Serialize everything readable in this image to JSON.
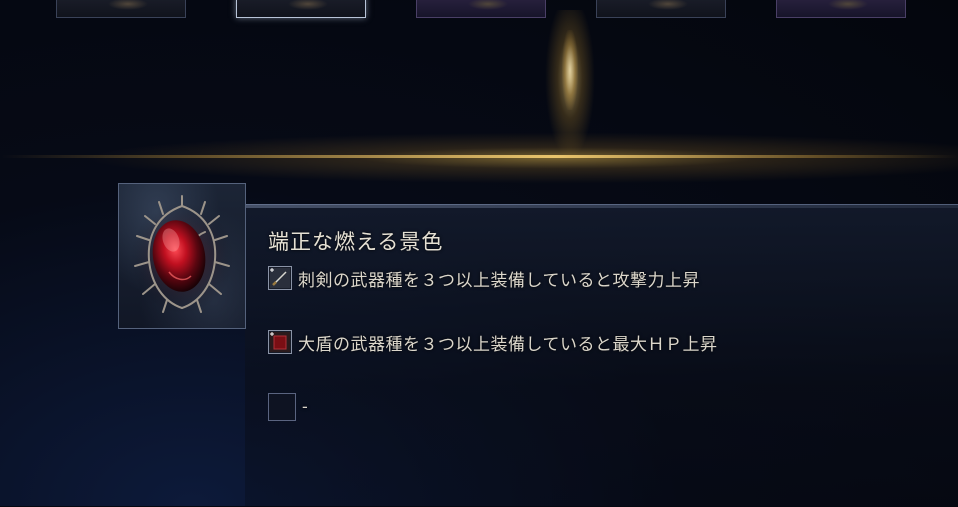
{
  "relic": {
    "name": "端正な燃える景色",
    "icon": "burning-relic-icon",
    "effects": [
      {
        "icon": "thrusting-sword-icon",
        "text": "刺剣の武器種を３つ以上装備していると攻撃力上昇"
      },
      {
        "icon": "greatshield-icon",
        "text": "大盾の武器種を３つ以上装備していると最大ＨＰ上昇"
      },
      {
        "icon": "empty-slot-icon",
        "text": "-"
      }
    ]
  },
  "colors": {
    "accent_gold": "#e0b860",
    "text": "#dcd7cb",
    "relic_red": "#c01020"
  }
}
